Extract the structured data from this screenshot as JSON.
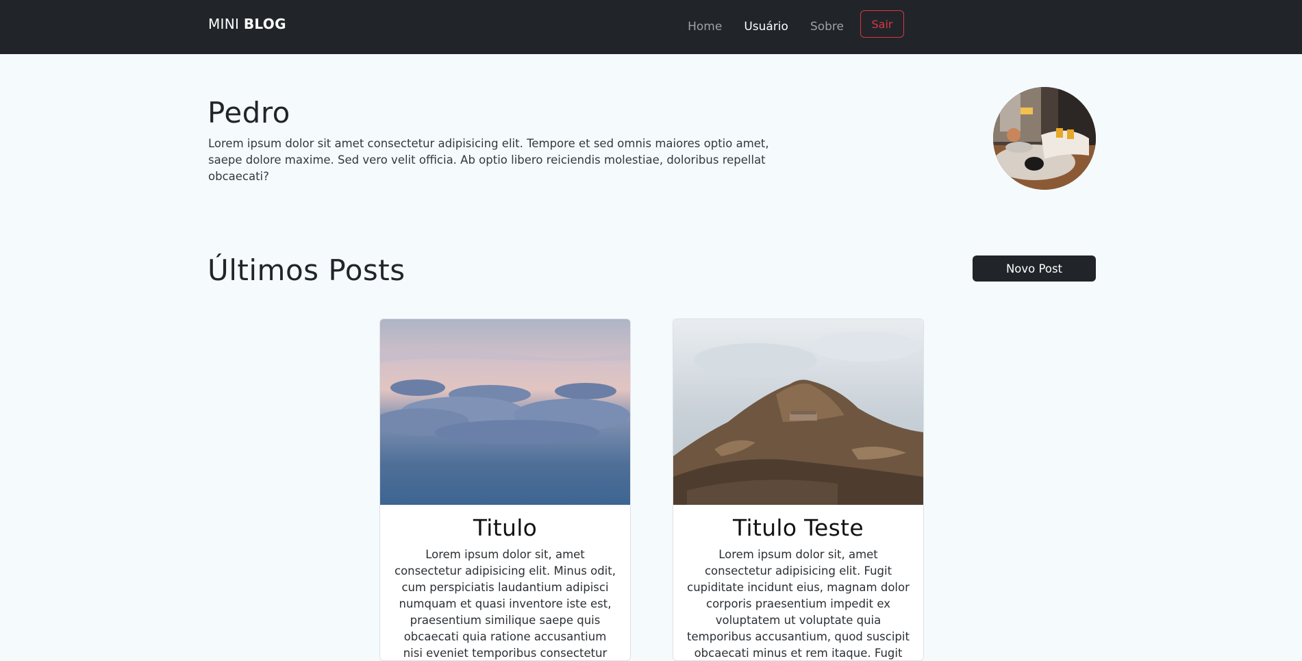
{
  "navbar": {
    "brand_light": "MINI",
    "brand_bold": "BLOG",
    "links": [
      {
        "label": "Home",
        "active": false
      },
      {
        "label": "Usuário",
        "active": true
      },
      {
        "label": "Sobre",
        "active": false
      }
    ],
    "logout_label": "Sair"
  },
  "profile": {
    "name": "Pedro",
    "bio": "Lorem ipsum dolor sit amet consectetur adipisicing elit. Tempore et sed omnis maiores optio amet, saepe dolore maxime. Sed vero velit officia. Ab optio libero reiciendis molestiae, doloribus repellat obcaecati?"
  },
  "posts_section": {
    "title": "Últimos Posts",
    "new_post_label": "Novo Post"
  },
  "posts": [
    {
      "title": "Titulo",
      "text": "Lorem ipsum dolor sit, amet consectetur adipisicing elit. Minus odit, cum perspiciatis laudantium adipisci numquam et quasi inventore iste est, praesentium similique saepe quis obcaecati quia ratione accusantium nisi eveniet temporibus consectetur provident"
    },
    {
      "title": "Titulo Teste",
      "text": "Lorem ipsum dolor sit, amet consectetur adipisicing elit. Fugit cupiditate incidunt eius, magnam dolor corporis praesentium impedit ex voluptatem ut voluptate quia temporibus accusantium, quod suscipit obcaecati minus et rem itaque. Fugit voluptatum velit modi nam"
    }
  ],
  "colors": {
    "navbar_bg": "#212529",
    "page_bg": "#f5fafd",
    "danger": "#dc3545",
    "primary_dark": "#212529"
  }
}
